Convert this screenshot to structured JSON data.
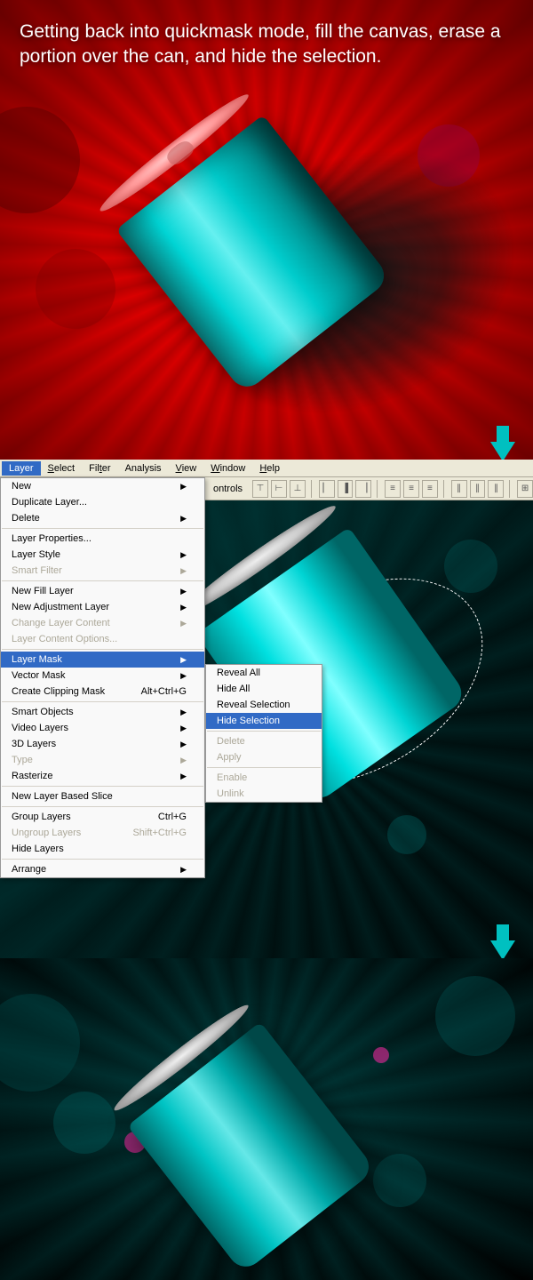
{
  "instruction": "Getting back into quickmask mode, fill the canvas, erase a portion over the can, and hide the selection.",
  "menubar": {
    "layer": "Layer",
    "select": "Select",
    "filter": "Filter",
    "analysis": "Analysis",
    "view": "View",
    "window": "Window",
    "help": "Help"
  },
  "toolbar_label": "ontrols",
  "layer_menu": {
    "new": "New",
    "duplicate": "Duplicate Layer...",
    "delete": "Delete",
    "properties": "Layer Properties...",
    "style": "Layer Style",
    "smart_filter": "Smart Filter",
    "new_fill": "New Fill Layer",
    "new_adjust": "New Adjustment Layer",
    "change_content": "Change Layer Content",
    "content_options": "Layer Content Options...",
    "layer_mask": "Layer Mask",
    "vector_mask": "Vector Mask",
    "clipping_mask": "Create Clipping Mask",
    "clipping_shortcut": "Alt+Ctrl+G",
    "smart_objects": "Smart Objects",
    "video_layers": "Video Layers",
    "three_d": "3D Layers",
    "type": "Type",
    "rasterize": "Rasterize",
    "slice": "New Layer Based Slice",
    "group": "Group Layers",
    "group_shortcut": "Ctrl+G",
    "ungroup": "Ungroup Layers",
    "ungroup_shortcut": "Shift+Ctrl+G",
    "hide": "Hide Layers",
    "arrange": "Arrange"
  },
  "submenu": {
    "reveal_all": "Reveal All",
    "hide_all": "Hide All",
    "reveal_selection": "Reveal Selection",
    "hide_selection": "Hide Selection",
    "delete": "Delete",
    "apply": "Apply",
    "enable": "Enable",
    "unlink": "Unlink"
  }
}
